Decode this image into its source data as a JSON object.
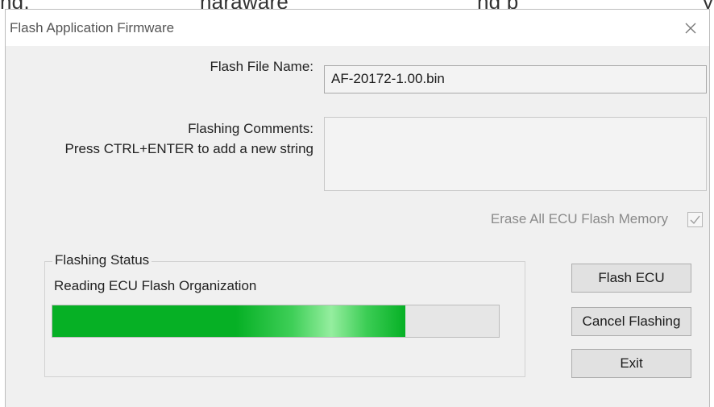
{
  "background_text": {
    "fragment_1": "ng,",
    "fragment_2": "naraware",
    "fragment_3": "ng p",
    "fragment_4": "y"
  },
  "window": {
    "title": "Flash Application Firmware",
    "close_icon": "close-icon"
  },
  "form": {
    "file_name_label": "Flash File Name:",
    "file_name_value": "AF-20172-1.00.bin",
    "comments_label": "Flashing Comments:",
    "comments_hint": "Press CTRL+ENTER to add a new string",
    "comments_value": "",
    "erase_label": "Erase All ECU Flash Memory",
    "erase_checked": true
  },
  "status": {
    "group_title": "Flashing Status",
    "message": "Reading ECU Flash Organization",
    "progress": 0.79
  },
  "buttons": {
    "flash": "Flash ECU",
    "cancel": "Cancel Flashing",
    "exit": "Exit"
  },
  "colors": {
    "progress_green": "#06b025",
    "dialog_bg": "#f0f0f0"
  }
}
